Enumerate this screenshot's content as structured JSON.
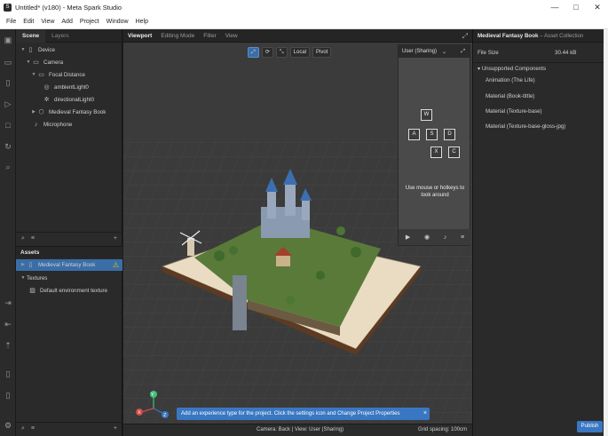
{
  "window": {
    "title": "Untitled* (v180) - Meta Spark Studio",
    "minimize": "—",
    "maximize": "□",
    "close": "✕"
  },
  "menu": [
    "File",
    "Edit",
    "View",
    "Add",
    "Project",
    "Window",
    "Help"
  ],
  "scene_panel": {
    "tabs": [
      "Scene",
      "Layers"
    ],
    "tree": [
      {
        "label": "Device",
        "icon": "device-icon",
        "depth": 0,
        "expanded": true
      },
      {
        "label": "Camera",
        "icon": "camera-icon",
        "depth": 1,
        "expanded": true
      },
      {
        "label": "Focal Distance",
        "icon": "focal-distance-icon",
        "depth": 2,
        "expanded": true
      },
      {
        "label": "ambientLight0",
        "icon": "ambient-light-icon",
        "depth": 3
      },
      {
        "label": "directionalLight0",
        "icon": "directional-light-icon",
        "depth": 3
      },
      {
        "label": "Medieval Fantasy Book",
        "icon": "3d-object-icon",
        "depth": 3,
        "expanded": false
      },
      {
        "label": "Microphone",
        "icon": "microphone-icon",
        "depth": 1
      }
    ]
  },
  "assets_panel": {
    "header": "Assets",
    "items": [
      {
        "label": "Medieval Fantasy Book",
        "selected": true,
        "warning": true
      },
      {
        "label": "Textures",
        "expanded": true
      },
      {
        "label": "Default environment texture"
      }
    ]
  },
  "viewport": {
    "tabs": [
      "Viewport",
      "Editing Mode",
      "Filter",
      "View"
    ],
    "tools": [
      "⤢",
      "⟳",
      "⤡",
      "Local",
      "Pivot"
    ],
    "sim": {
      "device": "User (Sharing)",
      "keys": [
        "W",
        "A",
        "S",
        "D",
        "X",
        "C"
      ],
      "hint": "Use mouse or hotkeys to look around"
    },
    "notification": "Add an experience type for the project. Click the settings icon and Change Project Properties",
    "status_camera": "Camera: Back | View: User (Sharing)",
    "status_grid": "Grid spacing: 100cm",
    "gizmo_axes": [
      "Y",
      "Z",
      "X"
    ]
  },
  "inspector": {
    "title": "Medieval Fantasy Book",
    "subtitle": "– Asset Collection",
    "file_size_label": "File Size",
    "file_size_value": "30.44 kB",
    "section": "Unsupported Components",
    "components": [
      "Animation (The Life)",
      "Material (Book-tittle)",
      "Material (Texture-base)",
      "Material (Texture-base-gloss-jpg)"
    ],
    "publish": "Publish"
  },
  "colors": {
    "accent": "#3a77c2",
    "warning": "#f0c300",
    "panel_bg": "#2a2a2a",
    "viewport_bg": "#3b3b3b"
  }
}
